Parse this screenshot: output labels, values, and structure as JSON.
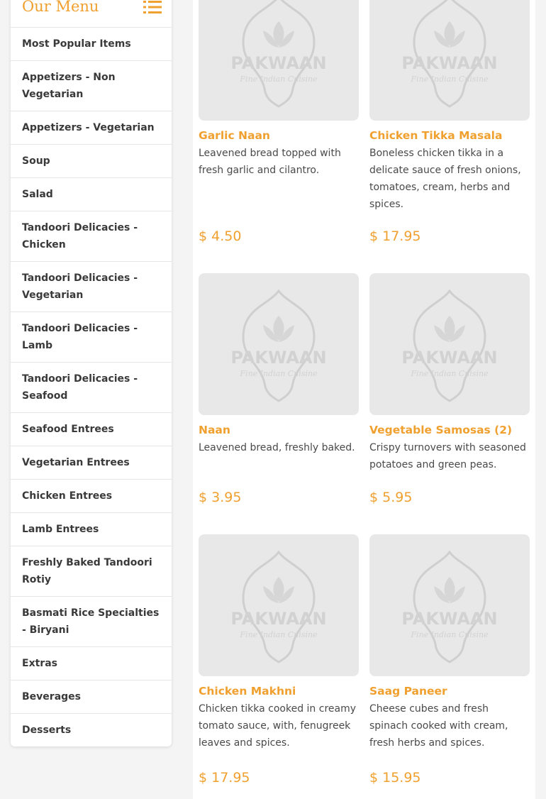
{
  "sidebar": {
    "title": "Our Menu",
    "items": [
      {
        "label": "Most Popular Items"
      },
      {
        "label": "Appetizers - Non Vegetarian"
      },
      {
        "label": "Appetizers - Vegetarian"
      },
      {
        "label": "Soup"
      },
      {
        "label": "Salad"
      },
      {
        "label": "Tandoori Delicacies - Chicken"
      },
      {
        "label": "Tandoori Delicacies - Vegetarian"
      },
      {
        "label": "Tandoori Delicacies - Lamb"
      },
      {
        "label": "Tandoori Delicacies - Seafood"
      },
      {
        "label": "Seafood Entrees"
      },
      {
        "label": "Vegetarian Entrees"
      },
      {
        "label": "Chicken Entrees"
      },
      {
        "label": "Lamb Entrees"
      },
      {
        "label": "Freshly Baked Tandoori Rotiy"
      },
      {
        "label": "Basmati Rice Specialties - Biryani"
      },
      {
        "label": "Extras"
      },
      {
        "label": "Beverages"
      },
      {
        "label": "Desserts"
      }
    ]
  },
  "placeholder_logo": {
    "brand": "PAKWAAN",
    "tagline": "Fine Indian Cuisine"
  },
  "items": [
    {
      "name": "Garlic Naan",
      "description": "Leavened bread topped with fresh garlic and cilantro.",
      "price": "$ 4.50"
    },
    {
      "name": "Chicken Tikka Masala",
      "description": "Boneless chicken tikka in a delicate sauce of fresh onions, tomatoes, cream, herbs and spices.",
      "price": "$ 17.95"
    },
    {
      "name": "Naan",
      "description": "Leavened bread, freshly baked.",
      "price": "$ 3.95"
    },
    {
      "name": "Vegetable Samosas (2)",
      "description": "Crispy turnovers with seasoned potatoes and green peas.",
      "price": "$ 5.95"
    },
    {
      "name": "Chicken Makhni",
      "description": "Chicken tikka cooked in creamy tomato sauce, with, fenugreek leaves and spices.",
      "price": "$ 17.95"
    },
    {
      "name": "Saag Paneer",
      "description": "Cheese cubes and fresh spinach cooked with cream, fresh herbs and spices.",
      "price": "$ 15.95"
    }
  ],
  "colors": {
    "accent": "#f0a02e",
    "text": "#3a3a3a",
    "placeholder_bg": "#e8e8e8"
  }
}
